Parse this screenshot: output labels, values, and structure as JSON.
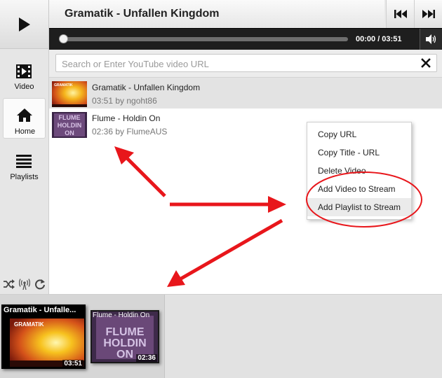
{
  "player": {
    "title": "Gramatik - Unfallen Kingdom",
    "time": "00:00 / 03:51",
    "progress": 0
  },
  "nav": {
    "items": [
      {
        "label": "Video",
        "icon": "film-icon",
        "active": false
      },
      {
        "label": "Home",
        "icon": "home-icon",
        "active": true
      },
      {
        "label": "Playlists",
        "icon": "list-icon",
        "active": false
      }
    ],
    "controls": [
      "shuffle-icon",
      "broadcast-icon",
      "repeat-icon"
    ]
  },
  "search": {
    "placeholder": "Search or Enter YouTube video URL"
  },
  "list": {
    "items": [
      {
        "title": "Gramatik - Unfallen Kingdom",
        "meta": "03:51 by ngoht86",
        "selected": true
      },
      {
        "title": "Flume - Holdin On",
        "meta": "02:36 by FlumeAUS",
        "selected": false
      }
    ]
  },
  "context_menu": {
    "items": [
      "Copy URL",
      "Copy Title - URL",
      "Delete Video",
      "Add Video to Stream",
      "Add Playlist to Stream"
    ],
    "highlighted": "Add Playlist to Stream"
  },
  "stream": {
    "items": [
      {
        "title": "Gramatik - Unfalle...",
        "duration": "03:51",
        "active": true
      },
      {
        "title": "Flume - Holdin On",
        "duration": "02:36",
        "active": false
      }
    ]
  },
  "thumbs": {
    "gramatik_text": "GRAMATIK",
    "flume_text": [
      "FLUME",
      "HOLDIN",
      "ON"
    ]
  },
  "colors": {
    "annotation": "#e8161b",
    "player_bar": "#1e1e1e",
    "selected_row": "#e3e3e3"
  }
}
